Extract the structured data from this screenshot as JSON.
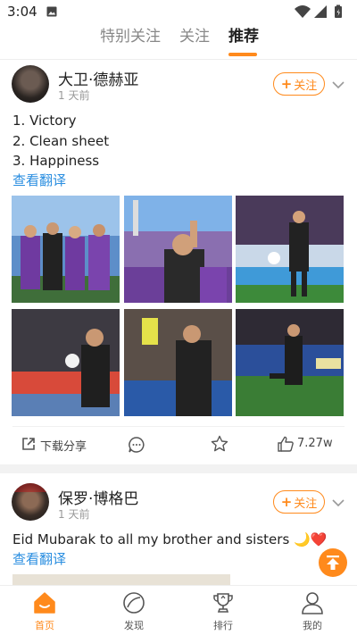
{
  "status_bar": {
    "time": "3:04",
    "icons": [
      "image-icon",
      "wifi-icon",
      "signal-icon",
      "battery-icon"
    ]
  },
  "top_tabs": {
    "items": [
      {
        "label": "特别关注",
        "active": false
      },
      {
        "label": "关注",
        "active": false
      },
      {
        "label": "推荐",
        "active": true
      }
    ]
  },
  "posts": [
    {
      "user_name": "大卫·德赫亚",
      "time": "1 天前",
      "follow_label": "关注",
      "lines": [
        "1. Victory",
        "2. Clean sheet",
        "3. Happiness"
      ],
      "translate_label": "查看翻译",
      "photo_count": 6,
      "actions": {
        "share_label": "下载分享",
        "like_count": "7.27w"
      }
    },
    {
      "user_name": "保罗·博格巴",
      "time": "1 天前",
      "follow_label": "关注",
      "lines": [
        "Eid Mubarak to all my brother and sisters 🌙❤️"
      ],
      "translate_label": "查看翻译"
    }
  ],
  "bottom_nav": {
    "items": [
      {
        "label": "首页",
        "icon": "home-icon",
        "active": true
      },
      {
        "label": "发现",
        "icon": "discover-icon",
        "active": false
      },
      {
        "label": "排行",
        "icon": "trophy-icon",
        "active": false
      },
      {
        "label": "我的",
        "icon": "profile-icon",
        "active": false
      }
    ]
  },
  "colors": {
    "accent": "#ff8a1c",
    "link": "#2a8ee0",
    "text": "#222222",
    "muted": "#999999"
  }
}
